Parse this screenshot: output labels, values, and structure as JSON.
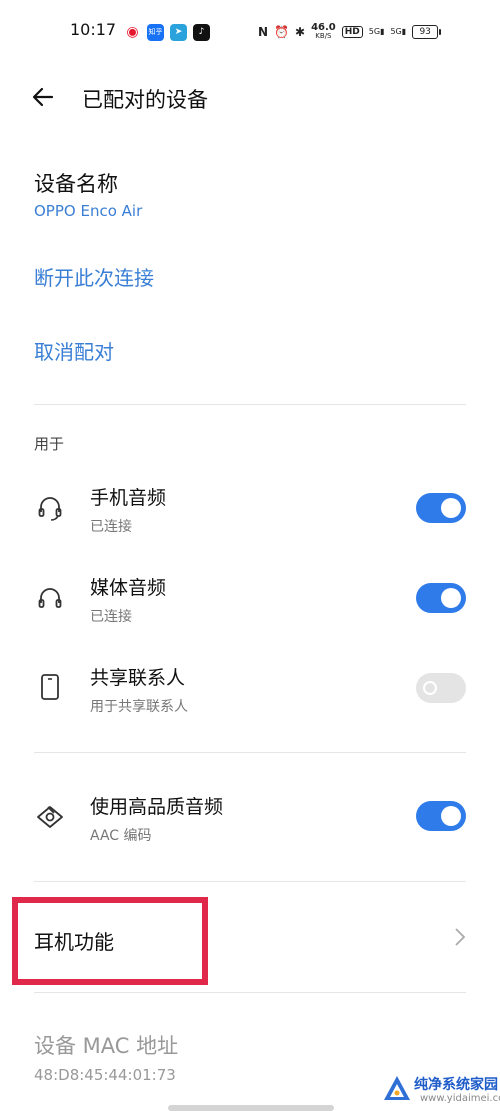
{
  "status_bar": {
    "time": "10:17",
    "apps": [
      {
        "name": "weibo-icon",
        "glyph": "◉",
        "color": "#ffffff",
        "fg": "#e6162d"
      },
      {
        "name": "zhihu-icon",
        "glyph": "知乎",
        "color": "#1772f6",
        "fg": "#ffffff"
      },
      {
        "name": "telegram-icon",
        "glyph": "➤",
        "color": "#2aa3dd",
        "fg": "#ffffff"
      },
      {
        "name": "tiktok-icon",
        "glyph": "♪",
        "color": "#111111",
        "fg": "#ffffff"
      }
    ],
    "speed_value": "46.0",
    "speed_unit": "KB/S",
    "hd_label": "HD",
    "net1_label": "5G",
    "net2_label": "5G",
    "battery": "93"
  },
  "header": {
    "title": "已配对的设备"
  },
  "device": {
    "section_title": "设备名称",
    "name": "OPPO Enco Air",
    "disconnect_label": "断开此次连接",
    "unpair_label": "取消配对"
  },
  "usage": {
    "label": "用于",
    "items": [
      {
        "title": "手机音频",
        "subtitle": "已连接",
        "icon": "headset-icon",
        "enabled": true
      },
      {
        "title": "媒体音频",
        "subtitle": "已连接",
        "icon": "headphones-icon",
        "enabled": true
      },
      {
        "title": "共享联系人",
        "subtitle": "用于共享联系人",
        "icon": "phone-icon",
        "enabled": false
      }
    ]
  },
  "quality": {
    "title": "使用高品质音频",
    "subtitle": "AAC 编码",
    "icon": "hifi-icon",
    "enabled": true
  },
  "earphone": {
    "title": "耳机功能",
    "highlight_color": "#e0294a"
  },
  "mac": {
    "title": "设备 MAC 地址",
    "value": "48:D8:45:44:01:73"
  },
  "watermark": {
    "text": "纯净系统家园",
    "url": "www.yidaimei.com"
  },
  "colors": {
    "accent": "#3a7fd5",
    "toggle_on": "#2f7bea",
    "toggle_off": "#e4e4e4"
  }
}
